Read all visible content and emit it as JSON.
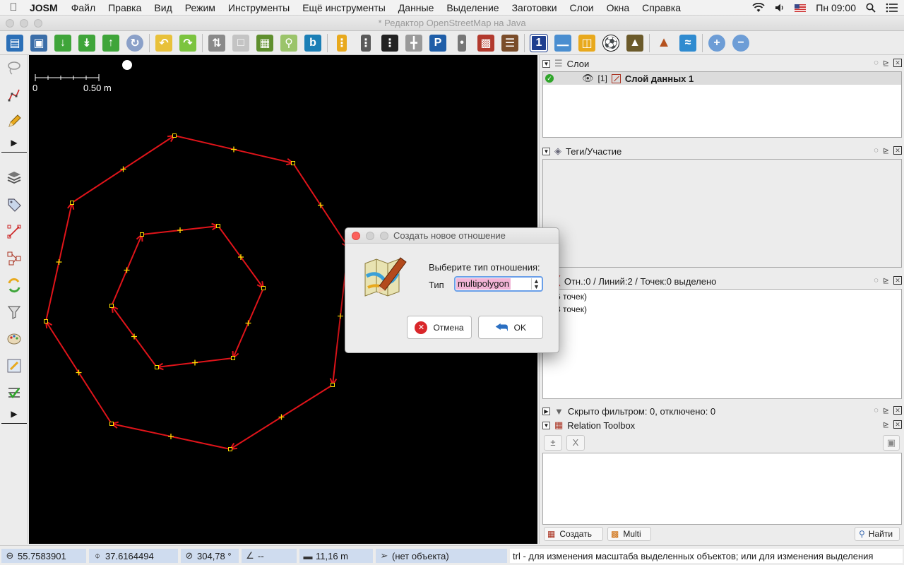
{
  "menubar": {
    "app_name": "JOSM",
    "items": [
      "Файл",
      "Правка",
      "Вид",
      "Режим",
      "Инструменты",
      "Ещё инструменты",
      "Данные",
      "Выделение",
      "Заготовки",
      "Слои",
      "Окна",
      "Справка"
    ],
    "clock": "Пн 09:00"
  },
  "window": {
    "title": "* Редактор OpenStreetMap на Java"
  },
  "map": {
    "scale_zero": "0",
    "scale_label": "0.50 m"
  },
  "layers": {
    "title": "Слои",
    "row": {
      "index": "[1]",
      "name": "Слой данных 1"
    }
  },
  "tags": {
    "title": "Теги/Участие"
  },
  "selection": {
    "title": "Отн.:0 / Линий:2 / Точек:0 выделено",
    "items": [
      "0 (6 точек)",
      "0 (8 точек)"
    ]
  },
  "filter": {
    "title": "Скрыто фильтром: 0, отключено: 0"
  },
  "relation_toolbox": {
    "title": "Relation Toolbox",
    "clear_label": "X",
    "create_label": "Создать",
    "multi_label": "Multi",
    "find_label": "Найти"
  },
  "statusbar": {
    "lat": "55.7583901",
    "lon": "37.6164494",
    "heading": "304,78 °",
    "angle": "--",
    "distance": "11,16 m",
    "object": "(нет объекта)",
    "help": "trl - для изменения масштаба выделенных объектов; или для изменения выделения"
  },
  "dialog": {
    "title": "Создать новое отношение",
    "prompt": "Выберите тип отношения:",
    "type_label": "Тип",
    "type_value": "multipolygon",
    "cancel_label": "Отмена",
    "ok_label": "OK"
  },
  "colors": {
    "way": "#e0141a",
    "node": "#ffe000",
    "map_bg": "#000000",
    "status_field": "#cfdcef",
    "focus": "#6a9fe8"
  }
}
